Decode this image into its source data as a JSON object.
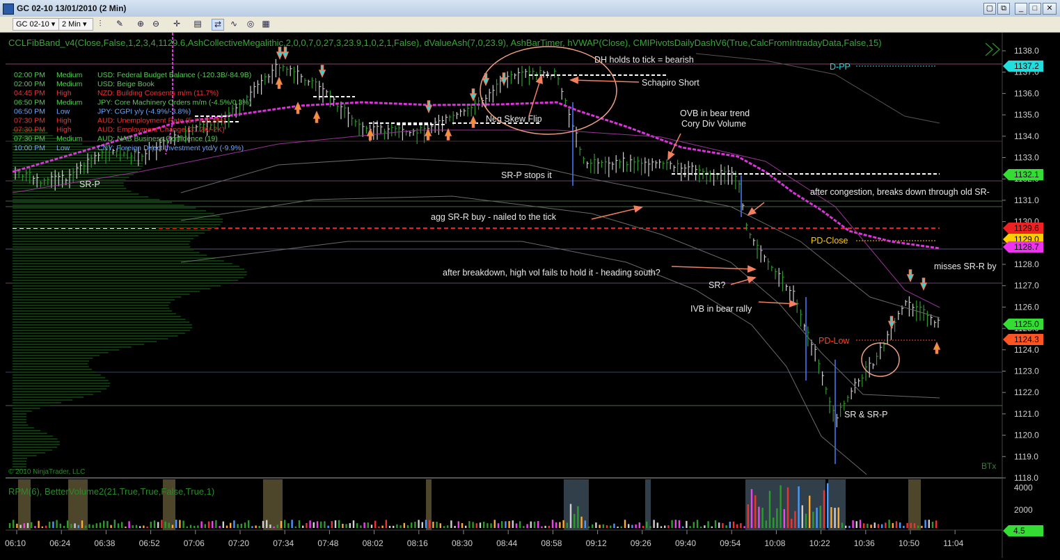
{
  "window": {
    "title": "GC 02-10  13/01/2010 (2 Min)"
  },
  "toolbar": {
    "instrument": "GC 02-10",
    "interval": "2 Min"
  },
  "indicator_label": "CCLFibBand_v4(Close,False,1,2,3,4,1129.6,AshCollectiveMegalithic,2,0,0,7,0,27,3,23.9,1,0,2,1,False), dValueAsh(7,0,23.9), AshBarTimer, hVWAP(Close), CMIPivotsDailyDashV6(True,CalcFromIntradayData,False,15)",
  "volume_label": "RPM(6), BetterVolume2(21,True,True,False,True,1)",
  "copyright": "© 2010 NinjaTrader, LLC",
  "btx": "BTx",
  "news": [
    {
      "time": "02:00 PM",
      "impact": "Medium",
      "text": "USD: Federal Budget Balance (-120.3B/-84.9B)",
      "color": "#55cc55"
    },
    {
      "time": "02:00 PM",
      "impact": "Medium",
      "text": "USD: Beige Book",
      "color": "#55cc55"
    },
    {
      "time": "04:45 PM",
      "impact": "High",
      "text": "NZD: Building Consents m/m (11.7%)",
      "color": "#ee3333"
    },
    {
      "time": "06:50 PM",
      "impact": "Medium",
      "text": "JPY: Core Machinery Orders m/m (-4.5%/0.3%)",
      "color": "#55cc55"
    },
    {
      "time": "06:50 PM",
      "impact": "Low",
      "text": "JPY: CGPI y/y (-4.9%/-3.8%)",
      "color": "#6fa8ff"
    },
    {
      "time": "07:30 PM",
      "impact": "High",
      "text": "AUD: Unemployment Rate (5.7%/5.8%)",
      "color": "#ee3333"
    },
    {
      "time": "07:30 PM",
      "impact": "High",
      "text": "AUD: Employment Change (31.2K/-2K)",
      "color": "#ee3333"
    },
    {
      "time": "07:30 PM",
      "impact": "Medium",
      "text": "AUD: NAB Business Confidence (19)",
      "color": "#55cc55"
    },
    {
      "time": "10:00 PM",
      "impact": "Low",
      "text": "CNY: Foreign Direct Investment ytd/y (-9.9%)",
      "color": "#6fa8ff"
    }
  ],
  "annotations": {
    "dh_holds": "DH holds to tick = bearish",
    "schapiro": "Schapiro Short",
    "neg_skew": "Neg Skew Flip",
    "ovb": "OVB in bear trend",
    "cory": "Cory Div Volume",
    "srp_left": "SR-P",
    "srp_stops": "SR-P stops it",
    "after_congestion": "after congestion, breaks down through old SR-",
    "agg_srr": "agg SR-R buy - nailed to the tick",
    "after_breakdown": "after breakdown, high vol fails to hold it - heading south?",
    "sr_q": "SR?",
    "ivb": "IVB in bear rally",
    "misses": "misses SR-R by",
    "sr_srp": "SR & SR-P",
    "dpp": "D-PP",
    "pd_close": "PD-Close",
    "pd_low": "PD-Low"
  },
  "price_axis": {
    "ticks": [
      "1138.0",
      "1137.0",
      "1136.0",
      "1135.0",
      "1134.0",
      "1133.0",
      "1132.0",
      "1131.0",
      "1130.0",
      "1129.0",
      "1128.0",
      "1127.0",
      "1126.0",
      "1125.0",
      "1124.0",
      "1123.0",
      "1122.0",
      "1121.0",
      "1120.0",
      "1119.0",
      "1118.0"
    ],
    "markers": [
      {
        "label": "1137.2",
        "color": "#22dddd"
      },
      {
        "label": "1132.1",
        "color": "#33dd33"
      },
      {
        "label": "1129.6",
        "color": "#ee2222"
      },
      {
        "label": "1129.0",
        "color": "#ffcc00"
      },
      {
        "label": "1128.7",
        "color": "#ee33ee"
      },
      {
        "label": "1125.0",
        "color": "#33dd33"
      },
      {
        "label": "1124.3",
        "color": "#ff5522"
      }
    ]
  },
  "volume_axis": {
    "ticks": [
      "4000",
      "2000"
    ],
    "marker": "4.5"
  },
  "time_axis": [
    "06:10",
    "06:24",
    "06:38",
    "06:52",
    "07:06",
    "07:20",
    "07:34",
    "07:48",
    "08:02",
    "08:16",
    "08:30",
    "08:44",
    "08:58",
    "09:12",
    "09:26",
    "09:40",
    "09:54",
    "10:08",
    "10:22",
    "10:36",
    "10:50",
    "11:04"
  ]
}
